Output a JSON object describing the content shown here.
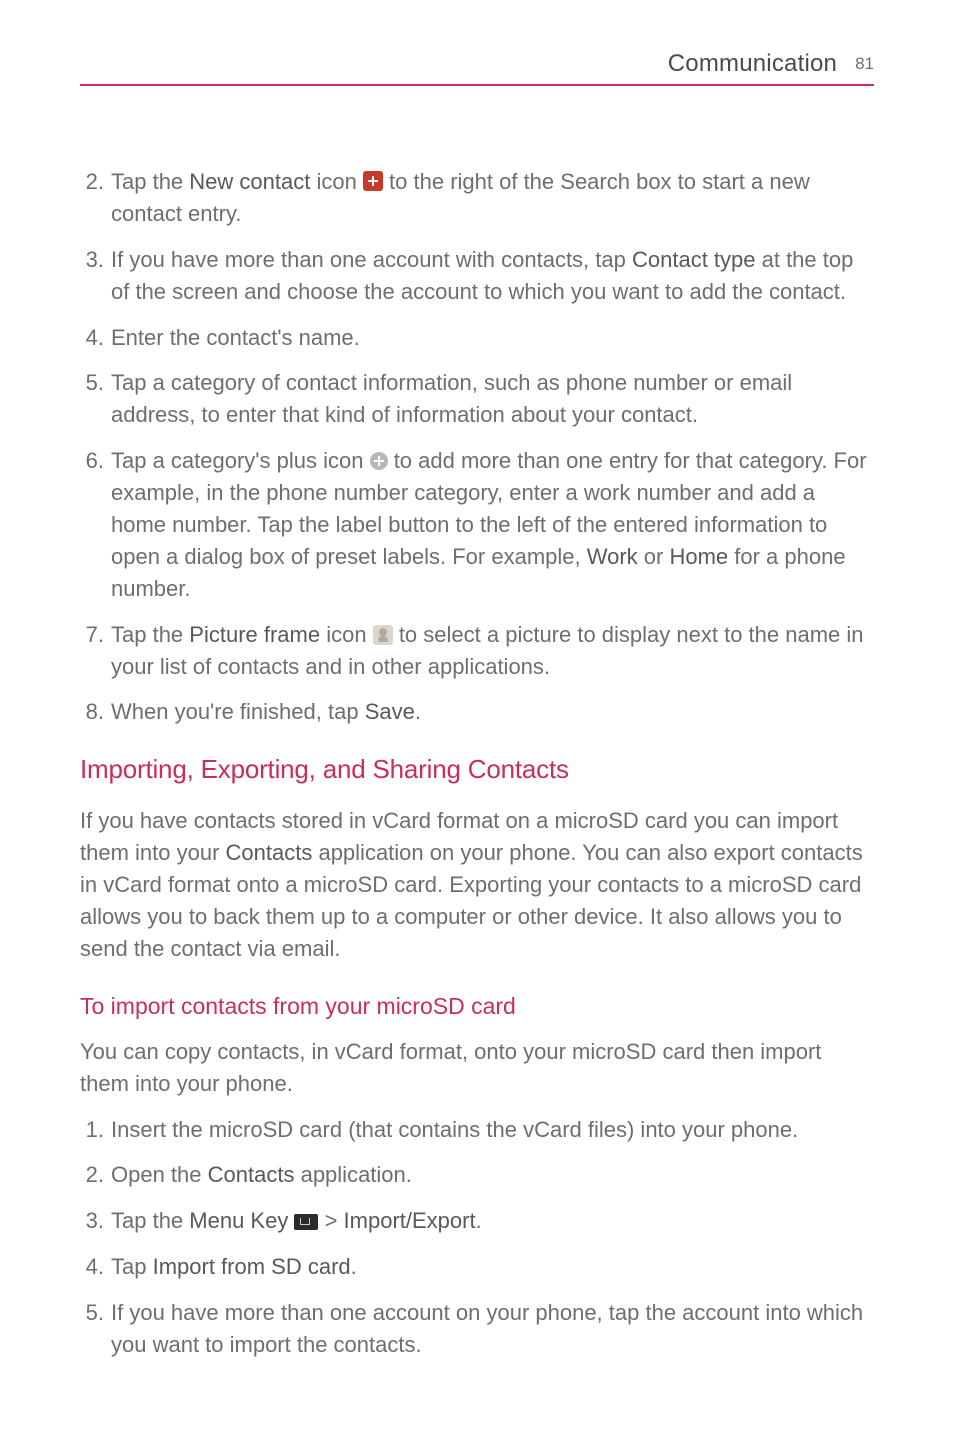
{
  "header": {
    "section": "Communication",
    "page_number": "81"
  },
  "steps_a": [
    {
      "num": "2.",
      "pre": "Tap the ",
      "bold1": "New contact",
      "mid1": " icon ",
      "icon": "red-plus",
      "post": " to the right of the Search box to start a new contact entry."
    },
    {
      "num": "3.",
      "pre": "If you have more than one account with contacts, tap ",
      "bold1": "Contact type",
      "post": " at the top of the screen and choose the account to which you want to add the contact."
    },
    {
      "num": "4.",
      "post": "Enter the contact's name."
    },
    {
      "num": "5.",
      "post": "Tap a category of contact information, such as phone number or email address, to enter that kind of information about your contact."
    },
    {
      "num": "6.",
      "pre": "Tap a category's plus icon ",
      "icon": "gray-plus",
      "mid1": " to add more than one entry for that category. For example, in the phone number category, enter a work number and add a home number. Tap the label button to the left of the entered information to open a dialog box of preset labels. For example, ",
      "bold1": "Work",
      "mid2": " or ",
      "bold2": "Home",
      "post": " for a phone number."
    },
    {
      "num": "7.",
      "pre": "Tap the ",
      "bold1": "Picture frame",
      "mid1": " icon ",
      "icon": "picture-frame",
      "post": " to select a picture to display next to the name in your list of contacts and in other applications."
    },
    {
      "num": "8.",
      "pre": "When you're finished, tap ",
      "bold1": "Save",
      "post": "."
    }
  ],
  "section2": {
    "title": "Importing, Exporting, and Sharing Contacts",
    "para_pre": "If you have contacts stored in vCard format on a microSD card you can import them into your ",
    "para_bold": "Contacts",
    "para_post": " application on your phone. You can also export contacts in vCard format onto a microSD card. Exporting your contacts to a microSD card allows you to back them up to a computer or other device. It also allows you to send the contact via email."
  },
  "section3": {
    "title": "To import contacts from your microSD card",
    "para": "You can copy contacts, in vCard format, onto your microSD card then import them into your phone."
  },
  "steps_b": [
    {
      "num": "1.",
      "post": "Insert the microSD card (that contains the vCard files) into your phone."
    },
    {
      "num": "2.",
      "pre": "Open the ",
      "bold1": "Contacts",
      "post": " application."
    },
    {
      "num": "3.",
      "pre": "Tap the ",
      "bold1": "Menu Key",
      "mid1": " ",
      "icon": "menu-key",
      "mid2": " > ",
      "bold2": "Import/Export",
      "post": "."
    },
    {
      "num": "4.",
      "pre": "Tap ",
      "bold1": "Import from SD card",
      "post": "."
    },
    {
      "num": "5.",
      "post": "If you have more than one account on your phone, tap the account into which you want to import the contacts."
    }
  ]
}
